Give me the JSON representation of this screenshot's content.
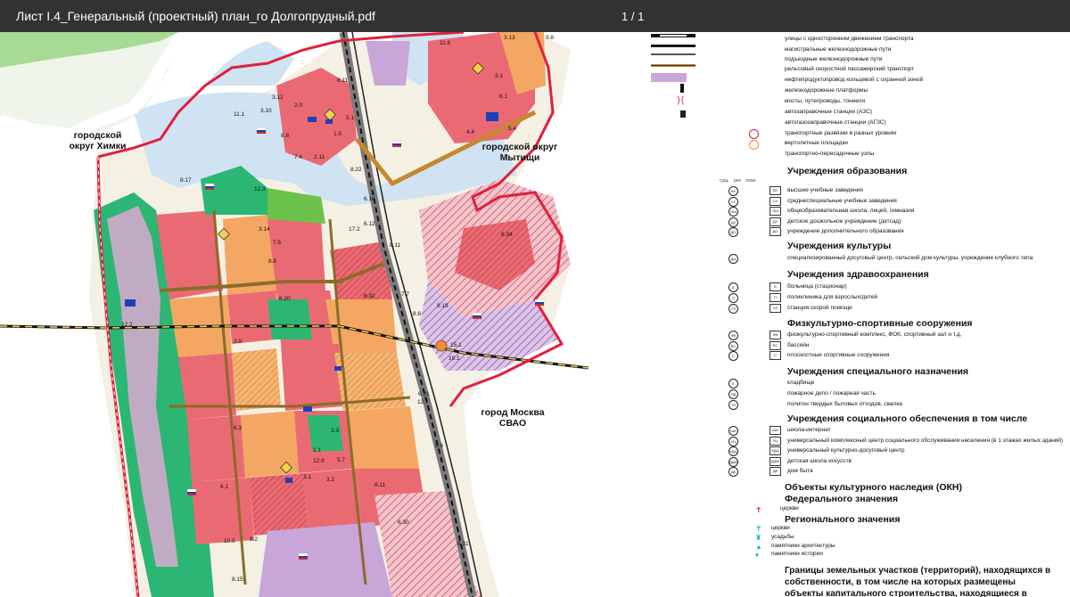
{
  "viewer": {
    "filename": "Лист I.4_Генеральный (проектный) план_го Долгопрудный.pdf",
    "page_indicator": "1 / 1"
  },
  "map": {
    "labels": {
      "khimki": "городской\nокруг Химки",
      "mytishchi": "городской округ\nМытищи",
      "moscow": "город Москва\nСВАО"
    },
    "zone_codes": [
      "11.6",
      "3.13",
      "9.8",
      "3.12",
      "8.11",
      "3.1",
      "6.1",
      "2.0",
      "5.1",
      "11.1",
      "3.10",
      "8.8",
      "1.5",
      "7.4",
      "2.11",
      "8.22",
      "12.3",
      "8.17",
      "6.16",
      "6.12",
      "3.14",
      "7.6",
      "17.2",
      "8.11",
      "6.34",
      "8.8",
      "6.20",
      "8.32",
      "7.7",
      "9.19",
      "3.9",
      "8.8",
      "15.1",
      "19.1",
      "6.21",
      "12.7",
      "8.6",
      "6.3",
      "3.3",
      "1.1",
      "12.9",
      "5.7",
      "3.1",
      "10.5",
      "6.1",
      "3.2",
      "8.11",
      "6.30",
      "8.15",
      "6.31",
      "12.2",
      "8.2",
      "4.4",
      "5.4"
    ],
    "colors": {
      "residential": "#e8606a",
      "public": "#f4a762",
      "green": "#2bb673",
      "water": "#cfe3f2",
      "industrial": "#c9a6d8",
      "boundary": "#e01f3d",
      "background": "#f4f1e4"
    }
  },
  "legend": {
    "top_items": [
      "улицы с односторонним движением транспорта",
      "магистральные железнодорожные пути",
      "подъездные железнодорожные пути",
      "рельсовый скоростной пассажирский транспорт",
      "нефтепродуктопровод кольцевой с охранной зоной",
      "железнодорожные платформы",
      "мосты, путепроводы, тоннели",
      "автозаправочные станции (АЗС)",
      "автогазозаправочные станции (АГЗС)",
      "транспортные развязки в разных уровнях",
      "вертолетные площадки",
      "транспортно-пересадочные узлы"
    ],
    "column_heads": [
      "сущ.",
      "рек",
      "план"
    ],
    "education": {
      "title": "Учреждения образования",
      "items": [
        {
          "code": "ВУ",
          "label": "высшие учебные заведения"
        },
        {
          "code": "СУ",
          "label": "среднеспециальные учебные заведения"
        },
        {
          "code": "ОШ",
          "label": "общеобразовательная школа, лицей, гимназия"
        },
        {
          "code": "ДУ",
          "label": "детское дошкольное учреждение (детсад)"
        },
        {
          "code": "ДО",
          "label": "учреждение дополнительного образования"
        }
      ]
    },
    "culture": {
      "title": "Учреждения культуры",
      "items": [
        {
          "code": "ДЦ",
          "label": "специализированный досуговый центр, сельский дом культуры, учреждение клубного типа"
        }
      ]
    },
    "health": {
      "title": "Учреждения здравоохранения",
      "items": [
        {
          "code": "Б",
          "label": "больница (стационар)"
        },
        {
          "code": "П",
          "label": "поликлиника для взрослых/детей"
        },
        {
          "code": "СП",
          "label": "станция скорой помощи"
        }
      ]
    },
    "sport": {
      "title": "Физкультурно-спортивные сооружения",
      "items": [
        {
          "code": "ФК",
          "label": "физкультурно-спортивный комплекс, ФОК, спортивный зал и т.д."
        },
        {
          "code": "БС",
          "label": "бассейн"
        },
        {
          "code": "С",
          "label": "плоскостные спортивные сооружения"
        }
      ]
    },
    "special": {
      "title": "Учреждения специального назначения",
      "items": [
        {
          "code": "К",
          "label": "кладбище"
        },
        {
          "code": "ПД",
          "label": "пожарное депо / пожарная часть"
        },
        {
          "code": "ТО",
          "label": "полигон твердых бытовых отходов, свалка"
        }
      ]
    },
    "social": {
      "title": "Учреждения социального обеспечения в том числе",
      "items": [
        {
          "code": "ШИ",
          "label": "школа-интернат"
        },
        {
          "code": "УЦ",
          "label": "универсальный комплексный центр социального обслуживания населения (в 1 этажах жилых зданий)"
        },
        {
          "code": "КДЦ",
          "label": "универсальный культурно-досуговый центр"
        },
        {
          "code": "ДШИ",
          "label": "детская школа искусств"
        },
        {
          "code": "ДБ",
          "label": "дом быта"
        }
      ]
    },
    "okn": {
      "title": "Объекты культурного наследия (ОКН)",
      "federal_title": "Федерального значения",
      "federal_items": [
        "церкви"
      ],
      "regional_title": "Регионального значения",
      "regional_items": [
        "церкви",
        "усадьбы",
        "памятники архитектуры",
        "памятники истории"
      ]
    },
    "bottom_title": "Границы земельных участков (территорий), находящихся в собственности, в том числе на которых размещены объекты капитального строительства, находящиеся в"
  }
}
